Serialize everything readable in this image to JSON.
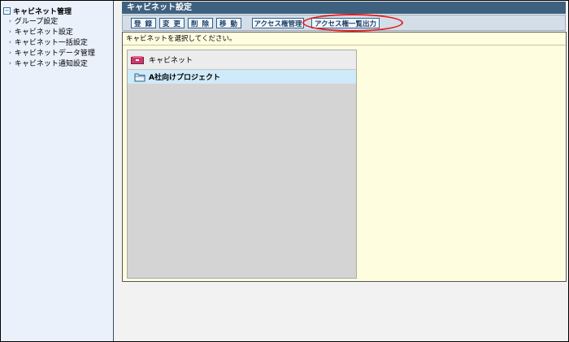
{
  "sidebar": {
    "root_icon": "minus",
    "root_label": "キャビネット管理",
    "items": [
      {
        "label": "グループ設定"
      },
      {
        "label": "キャビネット設定"
      },
      {
        "label": "キャビネット一括設定"
      },
      {
        "label": "キャビネットデータ管理"
      },
      {
        "label": "キャビネット通知設定"
      }
    ]
  },
  "main": {
    "title": "キャビネット設定",
    "toolbar": {
      "register": "登 録",
      "change": "変 更",
      "delete": "削 除",
      "move": "移 動",
      "access_manage": "アクセス権管理",
      "access_export": "アクセス権一覧出力"
    },
    "message": "キャビネットを選択してください。",
    "tree": {
      "header": "キャビネット",
      "items": [
        {
          "label": "A社向けプロジェクト"
        }
      ]
    }
  },
  "colors": {
    "title_bar": "#3f6180",
    "sidebar_bg": "#eaf1fb",
    "panel_bg": "#fffde0",
    "selected_row": "#cfeaf8",
    "highlight_ring": "#e41d1d"
  }
}
